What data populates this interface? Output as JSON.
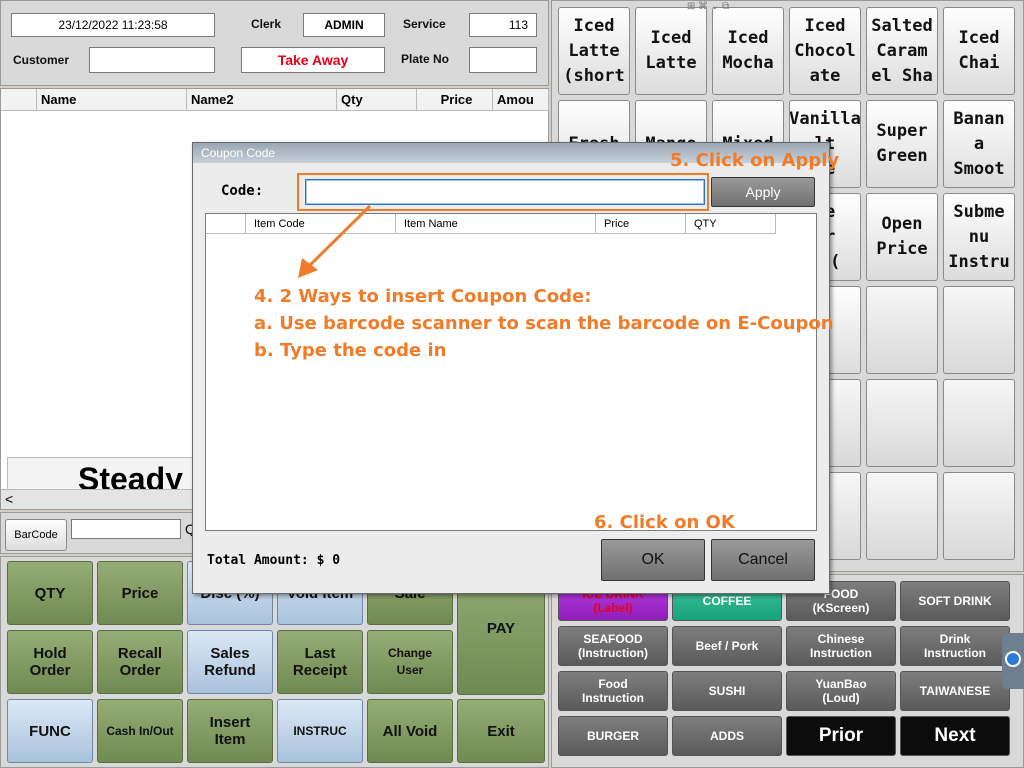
{
  "header": {
    "datetime": "23/12/2022 11:23:58",
    "clerk_label": "Clerk",
    "clerk_value": "ADMIN",
    "service_label": "Service",
    "service_value": "113",
    "customer_label": "Customer",
    "customer_value": "",
    "order_type": "Take Away",
    "plate_label": "Plate No",
    "plate_value": ""
  },
  "order_table": {
    "columns": [
      "Name",
      "Name2",
      "Qty",
      "Price",
      "Amou"
    ],
    "rows": [],
    "banner_text": "Steady",
    "scroll_left": "<"
  },
  "barcode": {
    "button_label": "BarCode",
    "input_value": "",
    "qty_hint": "Q"
  },
  "menu_items": [
    "Iced\nLatte\n(short",
    "Iced\nLatte",
    "Iced\nMocha",
    "Iced\nChocol\nate",
    "Salted\nCaram\nel Sha",
    "Iced\nChai",
    "Fresh",
    "Mango",
    "Mixed",
    "Vanilla\nlt\nke",
    "Super\nGreen",
    "Banan\na\nSmoot",
    "",
    "",
    "",
    "ke\nur\nn (",
    "Open\nPrice",
    "Subme\nnu\nInstru",
    "",
    "",
    "",
    "a",
    "",
    "",
    "",
    "",
    "",
    "",
    "",
    "",
    "",
    "",
    "",
    "",
    "",
    ""
  ],
  "function_buttons": [
    {
      "label": "QTY",
      "style": "green"
    },
    {
      "label": "Price",
      "style": "green"
    },
    {
      "label": "Disc (%)",
      "style": "blue"
    },
    {
      "label": "Void Item",
      "style": "blue"
    },
    {
      "label": "Sale",
      "style": "green"
    },
    {
      "label": "Hold\nOrder",
      "style": "green"
    },
    {
      "label": "Recall\nOrder",
      "style": "green"
    },
    {
      "label": "Sales\nRefund",
      "style": "blue"
    },
    {
      "label": "Last\nReceipt",
      "style": "green"
    },
    {
      "label": "Change\nUser",
      "style": "green"
    },
    {
      "label": "FUNC",
      "style": "blue"
    },
    {
      "label": "Cash In/Out",
      "style": "green"
    },
    {
      "label": "Insert\nItem",
      "style": "green"
    },
    {
      "label": "INSTRUC",
      "style": "blue"
    },
    {
      "label": "All Void",
      "style": "green"
    }
  ],
  "pay_label": "PAY",
  "exit_label": "Exit",
  "categories": [
    {
      "label": "ICE DRINK\n(Label)",
      "style": "purple"
    },
    {
      "label": "COFFEE",
      "style": "green"
    },
    {
      "label": "FOOD\n(KScreen)",
      "style": "gray"
    },
    {
      "label": "SOFT DRINK",
      "style": "gray"
    },
    {
      "label": "SEAFOOD\n(Instruction)",
      "style": "gray"
    },
    {
      "label": "Beef / Pork",
      "style": "gray"
    },
    {
      "label": "Chinese\nInstruction",
      "style": "gray"
    },
    {
      "label": "Drink\nInstruction",
      "style": "gray"
    },
    {
      "label": "Food\nInstruction",
      "style": "gray"
    },
    {
      "label": "SUSHI",
      "style": "gray"
    },
    {
      "label": "YuanBao\n(Loud)",
      "style": "gray"
    },
    {
      "label": "TAIWANESE",
      "style": "gray"
    },
    {
      "label": "BURGER",
      "style": "gray"
    },
    {
      "label": "ADDS",
      "style": "gray"
    },
    {
      "label": "Prior",
      "style": "black"
    },
    {
      "label": "Next",
      "style": "black"
    }
  ],
  "dialog": {
    "title": "Coupon Code",
    "code_label": "Code:",
    "code_value": "",
    "apply_label": "Apply",
    "columns": [
      "Item Code",
      "Item Name",
      "Price",
      "QTY"
    ],
    "total_label": "Total Amount: $ 0",
    "ok_label": "OK",
    "cancel_label": "Cancel"
  },
  "annotations": {
    "step4_title": "4. 2 Ways to insert Coupon Code:",
    "step4_a": "a. Use barcode scanner to scan the barcode on E-Coupon",
    "step4_b": "b. Type the code in",
    "step5": "5. Click on Apply",
    "step6": "6. Click on OK"
  },
  "colors": {
    "annotation": "#f07c2a",
    "function_green": "#7f9a60",
    "function_blue": "#bfd4ea",
    "category_gray": "#6a6a6a",
    "order_type_red": "#e8001a"
  }
}
